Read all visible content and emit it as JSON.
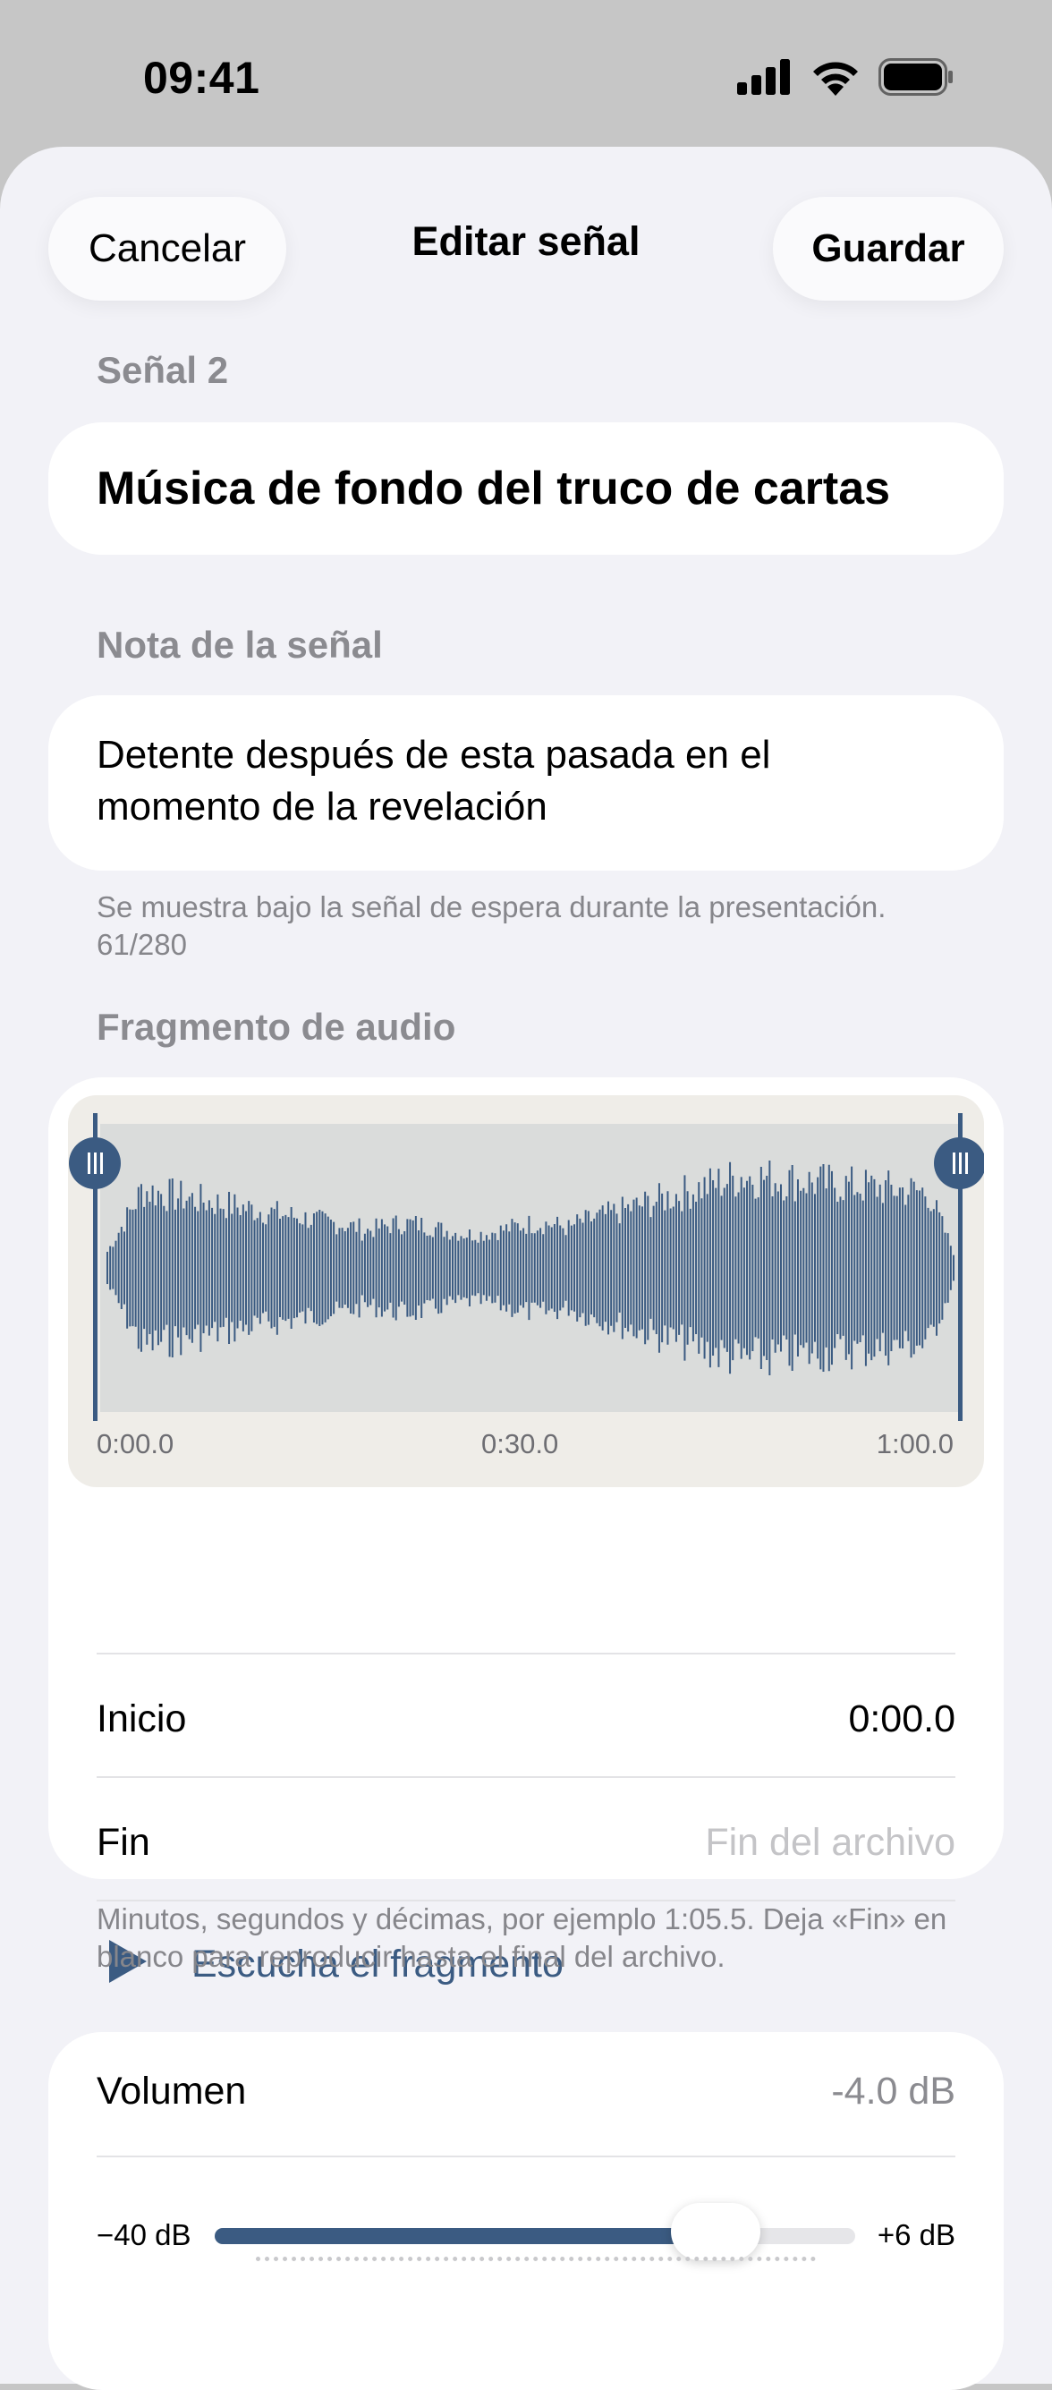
{
  "status_bar": {
    "time": "09:41"
  },
  "nav": {
    "cancel_label": "Cancelar",
    "title": "Editar señal",
    "save_label": "Guardar"
  },
  "cue": {
    "section_label": "Señal 2",
    "name": "Música de fondo del truco de cartas"
  },
  "note": {
    "section_label": "Nota de la señal",
    "text": "Detente después de esta pasada en el momento de la revelación",
    "hint": "Se muestra bajo la señal de espera durante la presentación. 61/280"
  },
  "audio": {
    "section_label": "Fragmento de audio",
    "ticks": [
      "0:00.0",
      "0:30.0",
      "1:00.0"
    ],
    "trim_start_fraction": 0.0,
    "trim_end_fraction": 1.0,
    "start_label": "Inicio",
    "start_value": "0:00.0",
    "end_label": "Fin",
    "end_placeholder": "Fin del archivo",
    "play_label": "Escucha el fragmento",
    "hint": "Minutos, segundos y décimas, por ejemplo 1:05.5. Deja «Fin» en blanco para reproducir hasta el final del archivo."
  },
  "volume": {
    "label": "Volumen",
    "value": "-4.0 dB",
    "min_label": "−40 dB",
    "max_label": "+6 dB",
    "min_db": -40,
    "max_db": 6,
    "current_db": -4.0
  },
  "colors": {
    "accent": "#3b5b82",
    "background": "#f2f2f7",
    "card": "#ffffff",
    "secondary_text": "#8b8b90"
  }
}
